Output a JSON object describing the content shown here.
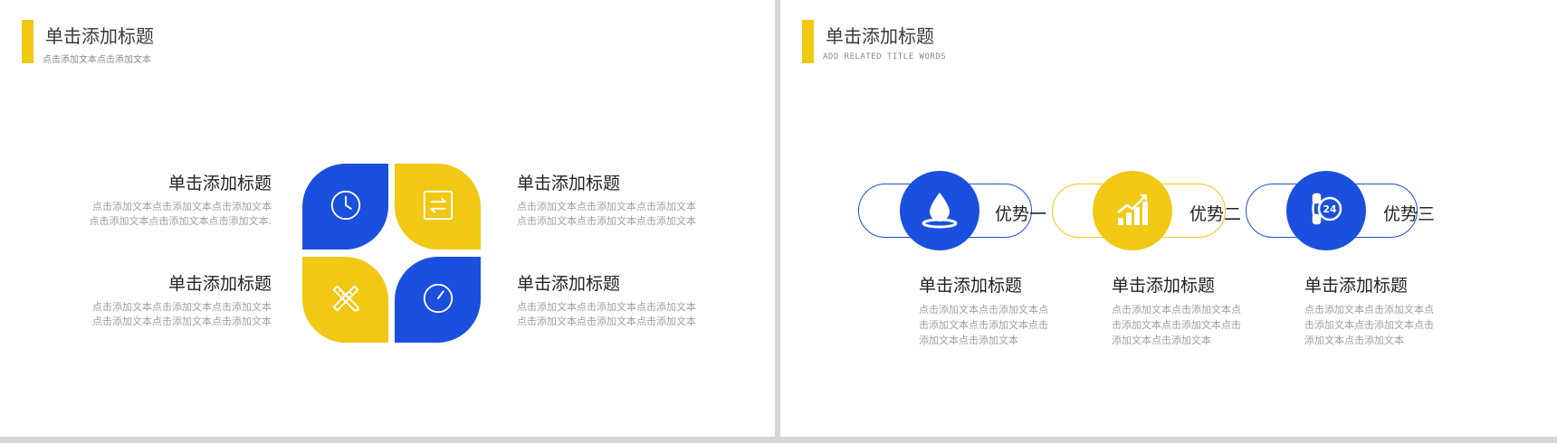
{
  "colors": {
    "blue": "#1b4fde",
    "yellow": "#f1c814",
    "background": "#ffffff"
  },
  "left_slide": {
    "title": "单击添加标题",
    "subtitle": "点击添加文本点击添加文本",
    "blocks": [
      {
        "title": "单击添加标题",
        "text_line1": "点击添加文本点击添加文本点击添加文本",
        "text_line2": "点击添加文本点击添加文本点击添加文本."
      },
      {
        "title": "单击添加标题",
        "text_line1": "点击添加文本点击添加文本点击添加文本",
        "text_line2": "点击添加文本点击添加文本点击添加文本"
      },
      {
        "title": "单击添加标题",
        "text_line1": "点击添加文本点击添加文本点击添加文本",
        "text_line2": "点击添加文本点击添加文本点击添加文本"
      },
      {
        "title": "单击添加标题",
        "text_line1": "点击添加文本点击添加文本点击添加文本",
        "text_line2": "点击添加文本点击添加文本点击添加文本"
      }
    ],
    "petal_icons": [
      "clock-icon",
      "swap-arrows-icon",
      "pencil-ruler-icon",
      "clock-icon"
    ]
  },
  "right_slide": {
    "title": "单击添加标题",
    "subtitle": "ADD RELATED TITLE WORDS",
    "advantages": [
      {
        "label": "优势一",
        "icon": "water-drop-icon",
        "color": "blue",
        "block_title": "单击添加标题",
        "block_text": "点击添加文本点击添加文本点击添加文本点击添加文本点击添加文本点击添加文本"
      },
      {
        "label": "优势二",
        "icon": "growth-chart-icon",
        "color": "yellow",
        "block_title": "单击添加标题",
        "block_text": "点击添加文本点击添加文本点击添加文本点击添加文本点击添加文本点击添加文本"
      },
      {
        "label": "优势三",
        "icon": "phone-24-icon",
        "color": "blue",
        "block_title": "单击添加标题",
        "block_text": "点击添加文本点击添加文本点击添加文本点击添加文本点击添加文本点击添加文本"
      }
    ]
  }
}
